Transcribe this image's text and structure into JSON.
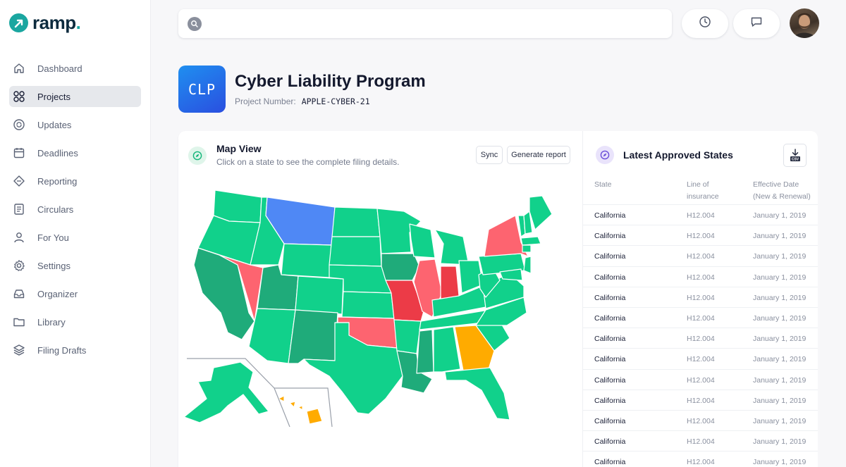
{
  "brand": {
    "name": "ramp",
    "dot": "."
  },
  "sidebar": {
    "items": [
      {
        "label": "Dashboard"
      },
      {
        "label": "Projects"
      },
      {
        "label": "Updates"
      },
      {
        "label": "Deadlines"
      },
      {
        "label": "Reporting"
      },
      {
        "label": "Circulars"
      },
      {
        "label": "For You"
      },
      {
        "label": "Settings"
      },
      {
        "label": "Organizer"
      },
      {
        "label": "Library"
      },
      {
        "label": "Filing Drafts"
      }
    ],
    "active_item": "Projects"
  },
  "search": {
    "value": "",
    "placeholder": ""
  },
  "header_icons": [
    "history-icon",
    "chat-icon"
  ],
  "project": {
    "badge": "CLP",
    "title": "Cyber Liability Program",
    "number_label": "Project Number:",
    "number": "APPLE-CYBER-21"
  },
  "map_view": {
    "title": "Map View",
    "subtitle": "Click on a state to see the complete filing details.",
    "sync_label": "Sync",
    "report_label": "Generate report",
    "colors": {
      "approved": "#11d18b",
      "approved_dark": "#1fab7a",
      "highlight_blue": "#4f88f5",
      "rejected": "#fd6470",
      "rejected_dark": "#ec3b47",
      "pending": "#ffab00"
    }
  },
  "approved_states": {
    "title": "Latest Approved States",
    "download_icon": "csv-download-icon",
    "columns": {
      "state": "State",
      "line_1": "Line of",
      "line_2": "insurance",
      "date_1": "Effective Date",
      "date_2": "(New & Renewal)"
    },
    "rows": [
      {
        "state": "California",
        "line": "H12.004",
        "date": "January 1, 2019"
      },
      {
        "state": "California",
        "line": "H12.004",
        "date": "January 1, 2019"
      },
      {
        "state": "California",
        "line": "H12.004",
        "date": "January 1, 2019"
      },
      {
        "state": "California",
        "line": "H12.004",
        "date": "January 1, 2019"
      },
      {
        "state": "California",
        "line": "H12.004",
        "date": "January 1, 2019"
      },
      {
        "state": "California",
        "line": "H12.004",
        "date": "January 1, 2019"
      },
      {
        "state": "California",
        "line": "H12.004",
        "date": "January 1, 2019"
      },
      {
        "state": "California",
        "line": "H12.004",
        "date": "January 1, 2019"
      },
      {
        "state": "California",
        "line": "H12.004",
        "date": "January 1, 2019"
      },
      {
        "state": "California",
        "line": "H12.004",
        "date": "January 1, 2019"
      },
      {
        "state": "California",
        "line": "H12.004",
        "date": "January 1, 2019"
      },
      {
        "state": "California",
        "line": "H12.004",
        "date": "January 1, 2019"
      },
      {
        "state": "California",
        "line": "H12.004",
        "date": "January 1, 2019"
      }
    ]
  }
}
